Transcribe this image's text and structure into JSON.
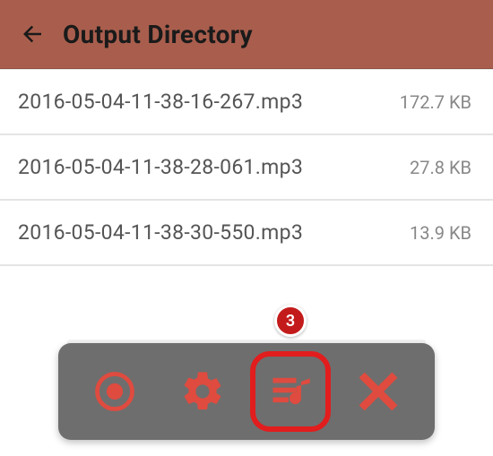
{
  "header": {
    "title": "Output Directory"
  },
  "files": [
    {
      "name": "2016-05-04-11-38-16-267.mp3",
      "size": "172.7 KB"
    },
    {
      "name": "2016-05-04-11-38-28-061.mp3",
      "size": "27.8 KB"
    },
    {
      "name": "2016-05-04-11-38-30-550.mp3",
      "size": "13.9 KB"
    }
  ],
  "annotation": {
    "badge_number": "3"
  },
  "colors": {
    "toolbar_bg": "#a95e4d",
    "accent": "#df4b3f",
    "highlight": "#e21d1d",
    "bar_bg": "#6e6e6e"
  },
  "icons": {
    "back": "arrow-left",
    "record": "record",
    "settings": "gear",
    "playlist": "playlist-music",
    "close": "close"
  }
}
